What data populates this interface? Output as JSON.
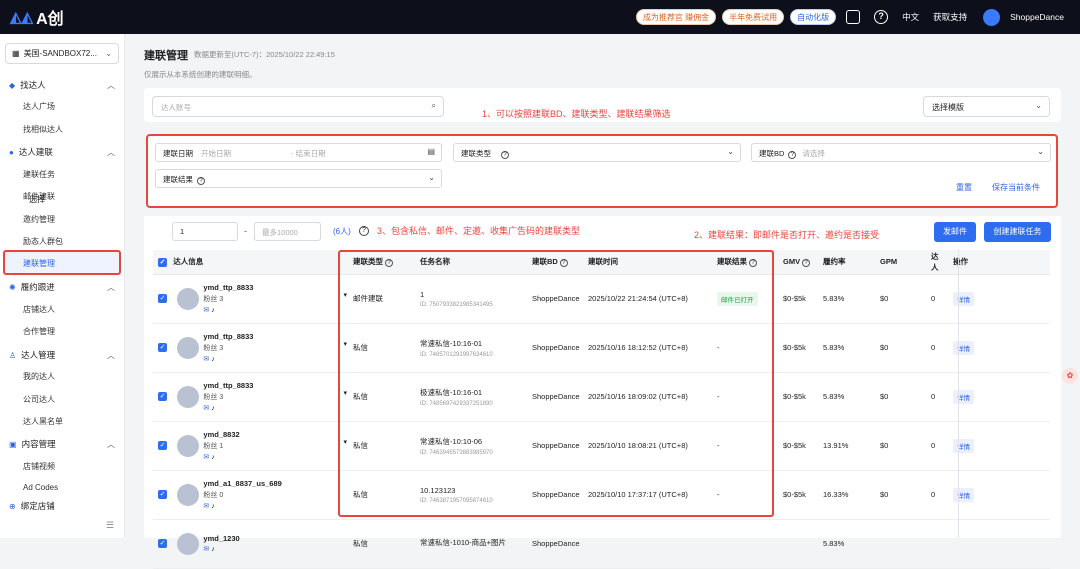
{
  "topbar": {
    "logo": "A创",
    "promo1": "成为推荐官 赚佣金",
    "promo2": "半年免费试用",
    "promo3": "自动化版",
    "lang": "中文",
    "support": "获取支持",
    "user": "ShoppeDance"
  },
  "sidebar": {
    "shop": "美国-SANDBOX72...",
    "groups": [
      {
        "label": "找达人",
        "items": [
          "达人广场",
          "找相似达人"
        ]
      },
      {
        "label": "达人建联",
        "items": [
          "建联任务",
          "邮件建联",
          "邀约管理",
          "励态人群包",
          "建联管理"
        ]
      },
      {
        "label": "履约跟进",
        "items": [
          "店铺达人",
          "合作管理"
        ]
      },
      {
        "label": "达人管理",
        "items": [
          "我的达人",
          "公司达人",
          "达人黑名单"
        ]
      },
      {
        "label": "内容管理",
        "items": [
          "店铺视频",
          "Ad Codes"
        ]
      },
      {
        "label": "绑定店铺",
        "items": []
      }
    ],
    "active": "建联管理"
  },
  "page": {
    "title": "建联管理",
    "update": "数据更新至(UTC-7)：2025/10/22 22:49:15",
    "note": "仅展示从本系统创建的建联明细。",
    "search_placeholder": "达人账号",
    "template": "选择模版"
  },
  "annotations": {
    "a1": "1、可以按照建联BD、建联类型、建联结果筛选",
    "a2": "2、建联结果：即邮件是否打开、邀约是否接受",
    "a3": "3、包含私信、邮件、定邀、收集广告码的建联类型"
  },
  "filters": {
    "date_label": "建联日期",
    "start_ph": "开始日期",
    "end_ph": "结束日期",
    "type_label": "建联类型",
    "bd_label": "建联BD",
    "bd_ph": "请选择",
    "result_label": "建联结果",
    "reset": "重置",
    "save": "保存当前条件"
  },
  "toolbar": {
    "select_label": "选择",
    "from": "1",
    "to_ph": "最多10000",
    "count": "(6人)",
    "send_mail": "发邮件",
    "create_task": "创建建联任务"
  },
  "table": {
    "headers": [
      "达人信息",
      "建联类型",
      "任务名称",
      "建联BD",
      "建联时间",
      "建联结果",
      "GMV",
      "履约率",
      "GPM",
      "达人",
      "操作"
    ],
    "rows": [
      {
        "name": "ymd_ttp_8833",
        "fans": "粉丝 3",
        "type": "邮件建联",
        "task": "1",
        "tid": "ID: 7507933821985341495",
        "bd": "ShoppeDance",
        "time": "2025/10/22 21:24:54 (UTC+8)",
        "result": "邮件已打开",
        "gmv": "$0-$5k",
        "rate": "5.83%",
        "gpm": "$0",
        "n": "0",
        "op": "详情"
      },
      {
        "name": "ymd_ttp_8833",
        "fans": "粉丝 3",
        "type": "私信",
        "task": "常速私信-10:16-01",
        "tid": "ID: 7485701291997634610",
        "bd": "ShoppeDance",
        "time": "2025/10/16 18:12:52 (UTC+8)",
        "result": "-",
        "gmv": "$0-$5k",
        "rate": "5.83%",
        "gpm": "$0",
        "n": "0",
        "op": "详情"
      },
      {
        "name": "ymd_ttp_8833",
        "fans": "粉丝 3",
        "type": "私信",
        "task": "极速私信-10:16-01",
        "tid": "ID: 7485697429337251890",
        "bd": "ShoppeDance",
        "time": "2025/10/16 18:09:02 (UTC+8)",
        "result": "-",
        "gmv": "$0-$5k",
        "rate": "5.83%",
        "gpm": "$0",
        "n": "0",
        "op": "详情"
      },
      {
        "name": "ymd_8832",
        "fans": "粉丝 1",
        "type": "私信",
        "task": "常速私信-10:10-06",
        "tid": "ID: 7463945573883985970",
        "bd": "ShoppeDance",
        "time": "2025/10/10 18:08:21 (UTC+8)",
        "result": "-",
        "gmv": "$0-$5k",
        "rate": "13.91%",
        "gpm": "$0",
        "n": "0",
        "op": "详情"
      },
      {
        "name": "ymd_a1_8837_us_689",
        "fans": "粉丝 0",
        "type": "私信",
        "task": "10.123123",
        "tid": "ID: 7463871957095874610",
        "bd": "ShoppeDance",
        "time": "2025/10/10 17:37:17 (UTC+8)",
        "result": "-",
        "gmv": "$0-$5k",
        "rate": "16.33%",
        "gpm": "$0",
        "n": "0",
        "op": "详情"
      },
      {
        "name": "ymd_1230",
        "fans": "",
        "type": "私信",
        "task": "常速私信-1010-商品+图片",
        "tid": "",
        "bd": "ShoppeDance",
        "time": "",
        "result": "",
        "gmv": "",
        "rate": "5.83%",
        "gpm": "",
        "n": "",
        "op": ""
      }
    ]
  },
  "colors": {
    "accent": "#2f6df0",
    "annotation": "#e8463c",
    "topbar": "#0d0f1a"
  }
}
